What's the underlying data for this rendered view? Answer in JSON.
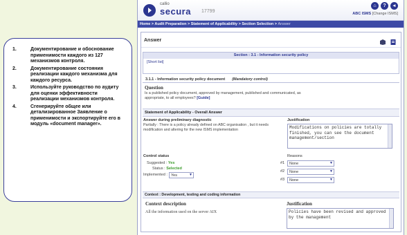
{
  "callout": {
    "items": [
      {
        "num": "1.",
        "text": "Документирование и обоснование применимости каждого из 127 механизмов контроля."
      },
      {
        "num": "2.",
        "text": "Документирование состояния реализации каждого механизма для каждого ресурса."
      },
      {
        "num": "3.",
        "text": "Используйте руководство по аудиту для оценки эффективности реализации механизмов контроля."
      },
      {
        "num": "4.",
        "text": "Сгенерируйте общее или детализированное Заявление о применимости и экспортируйте его в модуль «document manager»."
      }
    ]
  },
  "app": {
    "logo_small": "callio",
    "logo_name": "secura",
    "logo_version": "17799",
    "toolbar_icons": [
      "home-icon",
      "help-icon",
      "back-icon"
    ],
    "toolbar_glyphs": [
      "⌂",
      "?",
      "◂"
    ],
    "org_name": "ABC ISMS",
    "change_link": "[Change ISMS]",
    "breadcrumb": {
      "path": "Home > Audit Preparation > Statement of Applicability > Section Selection > ",
      "current": "Answer"
    }
  },
  "answer": {
    "title": "Answer",
    "section_title": "Section : 3.1 - Information security policy",
    "short_list": "[Short list]",
    "control_id": "3.1.1 - Information security policy document",
    "control_tag": "(Mandatory control)",
    "question_label": "Question",
    "question_text": "Is a published policy document, approved by management, published and communicated, as appropriate, to all employees?",
    "guide_link": "[Guide]",
    "soa_header": "Statement of Applicability - Overall Answer",
    "prelim_label": "Answer during preliminary diagnostic",
    "prelim_text": "Partially : There is a policy already defined on ABC organisation , but it needs modification and altering for the new ISMS implementation",
    "justification_label": "Justification",
    "justification_text": "Modifications on policies are totally finished, you can see the document management/section",
    "control_status_label": "Control status",
    "suggested_label": "Suggested :",
    "suggested_value": "Yes",
    "status_label": "Status :",
    "status_value": "Selected",
    "implemented_label": "Implemented :",
    "implemented_value": "Yes",
    "reasons_label": "Reasons",
    "reasons": [
      {
        "num": "#1",
        "value": "None"
      },
      {
        "num": "#2",
        "value": "None"
      },
      {
        "num": "#3",
        "value": "None"
      }
    ],
    "context_header": "Context : Development, testing and coding information",
    "context_desc_label": "Context description",
    "context_desc_text": "All the information used on the server AIX",
    "context_just_label": "Justification",
    "context_just_text": "Policies have been revised and approved by the management"
  },
  "colors": {
    "accent": "#2b3590",
    "ok": "#3a9a2a",
    "background": "#f1f6df"
  }
}
